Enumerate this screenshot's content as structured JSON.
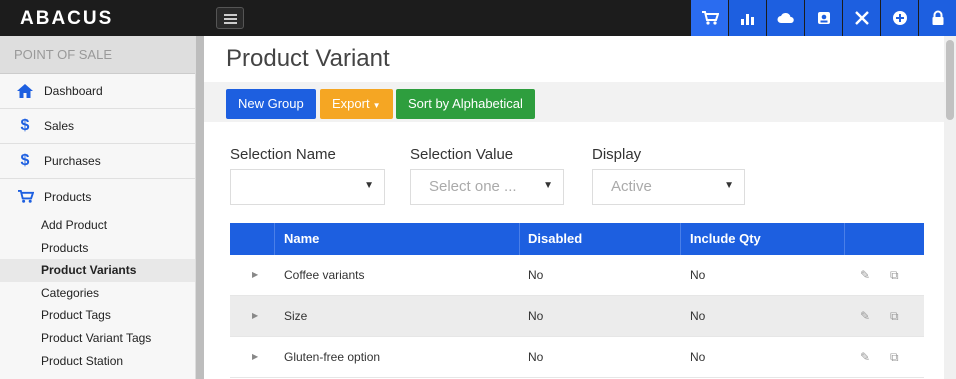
{
  "app": {
    "logo": "ABACUS"
  },
  "topbar": {
    "icons": [
      "cart-icon",
      "chart-icon",
      "cloud-icon",
      "contact-icon",
      "tools-icon",
      "plus-circle-icon",
      "lock-icon"
    ],
    "accent": "#1d5fe0"
  },
  "sidebar": {
    "section": "POINT OF SALE",
    "items": [
      {
        "label": "Dashboard",
        "icon": "home-icon"
      },
      {
        "label": "Sales",
        "icon": "dollar-icon"
      },
      {
        "label": "Purchases",
        "icon": "dollar-icon"
      },
      {
        "label": "Products",
        "icon": "cart-icon"
      }
    ],
    "subitems": [
      "Add Product",
      "Products",
      "Product Variants",
      "Categories",
      "Product Tags",
      "Product Variant Tags",
      "Product Station"
    ],
    "active_subitem": "Product Variants"
  },
  "main": {
    "title": "Product Variant",
    "toolbar": {
      "new_group": "New Group",
      "export": "Export",
      "sort": "Sort by Alphabetical"
    },
    "filters": [
      {
        "label": "Selection Name",
        "value": ""
      },
      {
        "label": "Selection Value",
        "value": "Select one ..."
      },
      {
        "label": "Display",
        "value": "Active"
      }
    ],
    "table": {
      "headers": [
        "Name",
        "Disabled",
        "Include Qty"
      ],
      "rows": [
        {
          "name": "Coffee variants",
          "disabled": "No",
          "include_qty": "No"
        },
        {
          "name": "Size",
          "disabled": "No",
          "include_qty": "No"
        },
        {
          "name": "Gluten-free option",
          "disabled": "No",
          "include_qty": "No"
        }
      ]
    }
  }
}
